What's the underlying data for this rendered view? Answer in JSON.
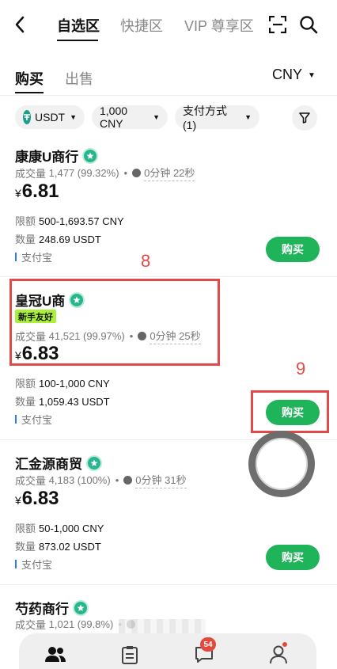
{
  "nav": {
    "tabs": [
      "自选区",
      "快捷区",
      "VIP 尊享区"
    ]
  },
  "subnav": {
    "tabs": [
      "购买",
      "出售"
    ],
    "currency": "CNY"
  },
  "filters": {
    "coin": "USDT",
    "amount": "1,000 CNY",
    "payment": "支付方式 (1)"
  },
  "labels": {
    "volume_prefix": "成交量",
    "limit_prefix": "限额",
    "qty_prefix": "数量",
    "currency_symbol": "¥",
    "buy_button": "购买",
    "new_user_tag": "新手友好"
  },
  "merchants": [
    {
      "name": "康康U商行",
      "volume": "1,477 (99.32%)",
      "time": "0分钟 22秒",
      "price": "6.81",
      "limit": "500-1,693.57 CNY",
      "qty": "248.69 USDT",
      "payment": "支付宝"
    },
    {
      "name": "皇冠U商",
      "volume": "41,521 (99.97%)",
      "time": "0分钟 25秒",
      "price": "6.83",
      "limit": "100-1,000 CNY",
      "qty": "1,059.43 USDT",
      "payment": "支付宝"
    },
    {
      "name": "汇金源商贸",
      "volume": "4,183 (100%)",
      "time": "0分钟 31秒",
      "price": "6.83",
      "limit": "50-1,000 CNY",
      "qty": "873.02 USDT",
      "payment": "支付宝"
    },
    {
      "name": "芍药商行",
      "volume": "1,021 (99.8%)"
    }
  ],
  "annotations": {
    "box8": "8",
    "box9": "9"
  },
  "bottom_nav": {
    "message_badge": "54"
  },
  "colors": {
    "buy_green": "#1fb35a",
    "annotation_red": "#e24a4a",
    "tag_lime": "#a8f03a"
  }
}
